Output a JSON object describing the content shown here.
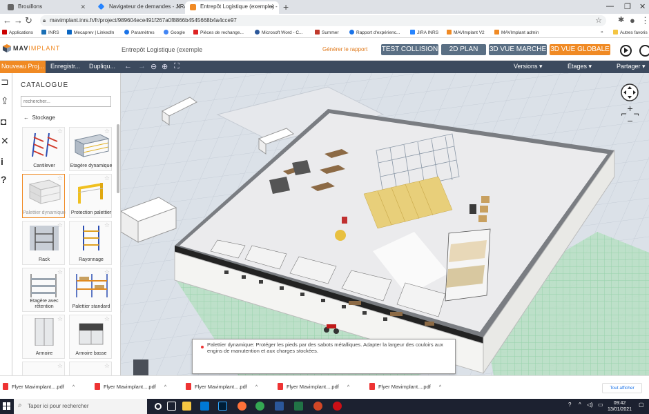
{
  "browser": {
    "tabs": [
      {
        "label": "Brouillons",
        "active": false
      },
      {
        "label": "Navigateur de demandes - JIRA I",
        "active": false
      },
      {
        "label": "Entrepôt Logistique (exemple) - I",
        "active": true
      }
    ],
    "url": "mavimplant.inrs.fr/fr/project/989604ece491f267a0f8866b4545668b4a4cce97",
    "bookmarks": [
      "Applications",
      "INRS",
      "Mecaprev | LinkedIn",
      "Paramètres",
      "Google",
      "Pièces de rechange...",
      "Microsoft Word - C...",
      "Summer",
      "Rapport d'expérienc...",
      "JIRA INRS",
      "MAVImplant V2",
      "MAVImplant admin",
      "Autres favoris"
    ]
  },
  "app": {
    "logo": {
      "mav": "MAV",
      "implant": "IMPLANT"
    },
    "project_title": "Entrepôt Logistique (exemple",
    "generate_report": "Générer le rapport",
    "view_buttons": [
      "TEST COLLISION",
      "2D PLAN",
      "3D VUE MARCHE",
      "3D VUE GLOBALE"
    ],
    "active_view": "3D VUE GLOBALE",
    "accent_color": "#f08a24",
    "toolbar": {
      "new_project": "Nouveau Proj...",
      "save": "Enregistr...",
      "duplicate": "Dupliqu...",
      "versions": "Versions",
      "floors": "Étages",
      "share": "Partager"
    }
  },
  "catalogue": {
    "title": "CATALOGUE",
    "search_placeholder": "rechercher...",
    "category": "Stockage",
    "items": [
      {
        "label": "Cantilever",
        "selected": false
      },
      {
        "label": "Etagère dynamique",
        "selected": false
      },
      {
        "label": "Palettier dynamique",
        "selected": true
      },
      {
        "label": "Protection palettier",
        "selected": false
      },
      {
        "label": "Rack",
        "selected": false
      },
      {
        "label": "Rayonnage",
        "selected": false
      },
      {
        "label": "Etagère avec rétention",
        "selected": false
      },
      {
        "label": "Palettier standard",
        "selected": false
      },
      {
        "label": "Armoire",
        "selected": false
      },
      {
        "label": "Armoire basse",
        "selected": false
      }
    ]
  },
  "tooltip": {
    "text": "Palettier dynamique: Protéger les pieds par des sabots métalliques. Adapter la largeur des couloirs aux engins de manutention et aux charges stockées."
  },
  "downloads": {
    "items": [
      "Flyer Mavimplant....pdf",
      "Flyer Mavimplant....pdf",
      "Flyer Mavimplant....pdf",
      "Flyer Mavimplant....pdf",
      "Flyer Mavimplant....pdf"
    ],
    "show_all": "Tout afficher"
  },
  "taskbar": {
    "search_placeholder": "Taper ici pour rechercher",
    "time": "09:42",
    "date": "13/01/2021"
  }
}
